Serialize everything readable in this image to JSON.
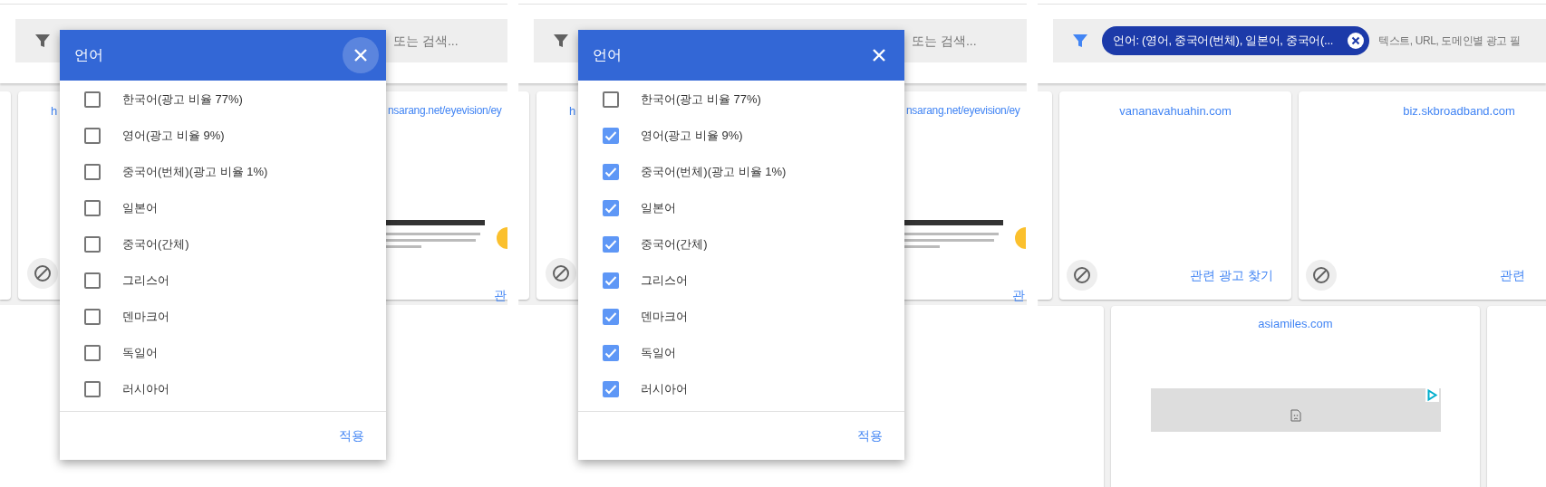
{
  "panels": [
    {
      "kind": "dialog",
      "search": {
        "placeholder": "또는 검색..."
      },
      "cards": [
        {
          "url": "h"
        },
        {
          "url": "nsarang.net/eyevision/ey",
          "action": "관"
        }
      ],
      "dialog": {
        "title": "언어",
        "close_highlighted": true,
        "apply": "적용",
        "options": [
          {
            "label": "한국어(광고 비율 77%)",
            "checked": false
          },
          {
            "label": "영어(광고 비율 9%)",
            "checked": false
          },
          {
            "label": "중국어(번체)(광고 비율 1%)",
            "checked": false
          },
          {
            "label": "일본어",
            "checked": false
          },
          {
            "label": "중국어(간체)",
            "checked": false
          },
          {
            "label": "그리스어",
            "checked": false
          },
          {
            "label": "덴마크어",
            "checked": false
          },
          {
            "label": "독일어",
            "checked": false
          },
          {
            "label": "러시아어",
            "checked": false
          }
        ]
      }
    },
    {
      "kind": "dialog",
      "search": {
        "placeholder": "또는 검색..."
      },
      "cards": [
        {
          "url": "h"
        },
        {
          "url": "nsarang.net/eyevision/ey",
          "action": "관"
        }
      ],
      "dialog": {
        "title": "언어",
        "close_highlighted": false,
        "apply": "적용",
        "options": [
          {
            "label": "한국어(광고 비율 77%)",
            "checked": false
          },
          {
            "label": "영어(광고 비율 9%)",
            "checked": true
          },
          {
            "label": "중국어(번체)(광고 비율 1%)",
            "checked": true
          },
          {
            "label": "일본어",
            "checked": true
          },
          {
            "label": "중국어(간체)",
            "checked": true
          },
          {
            "label": "그리스어",
            "checked": true
          },
          {
            "label": "덴마크어",
            "checked": true
          },
          {
            "label": "독일어",
            "checked": true
          },
          {
            "label": "러시아어",
            "checked": true
          }
        ]
      }
    },
    {
      "kind": "results",
      "search": {
        "placeholder": "텍스트, URL, 도메인별 광고 필"
      },
      "filter_chip": {
        "label": "언어: (영어, 중국어(번체), 일본어, 중국어(..."
      },
      "cards": [
        {
          "url": "vananavahuahin.com",
          "action": "관련 광고 찾기"
        },
        {
          "url": "biz.skbroadband.com",
          "action": "관련"
        }
      ],
      "cards_row_2": [
        {
          "url": "asiamiles.com",
          "ad": {
            "kind": "broken"
          }
        }
      ]
    }
  ]
}
